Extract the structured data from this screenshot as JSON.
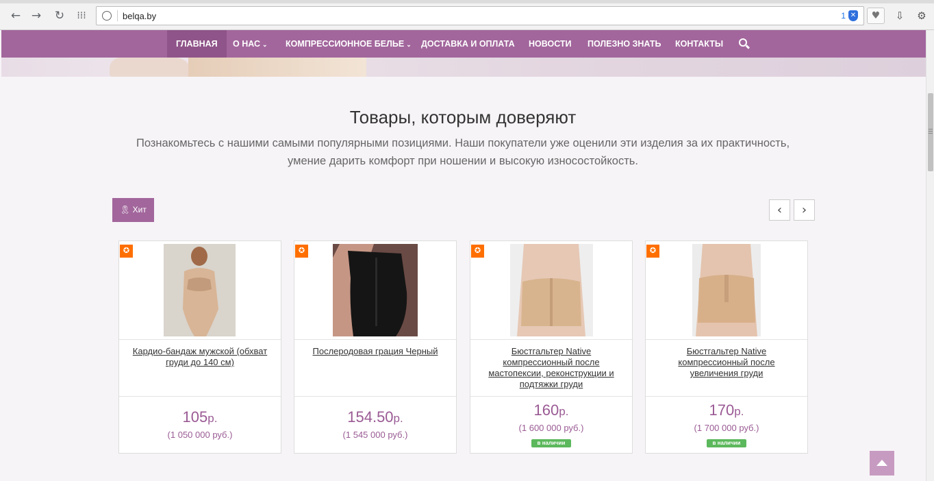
{
  "browser": {
    "url": "belqa.by",
    "counter": "1",
    "back_icon": "back-arrow-icon",
    "forward_icon": "forward-arrow-icon",
    "reload_icon": "reload-icon",
    "apps_icon": "apps-grid-icon"
  },
  "nav": {
    "items": [
      {
        "label": "ГЛАВНАЯ"
      },
      {
        "label": "О НАС"
      },
      {
        "label": "КОМПРЕССИОННОЕ БЕЛЬЕ"
      },
      {
        "label": "ДОСТАВКА И ОПЛАТА"
      },
      {
        "label": "НОВОСТИ"
      },
      {
        "label": "ПОЛЕЗНО ЗНАТЬ"
      },
      {
        "label": "КОНТАКТЫ"
      }
    ],
    "chevron": "⌄"
  },
  "section": {
    "title": "Товары, которым доверяют",
    "description": "Познакомьтесь с нашими самыми популярными позициями. Наши покупатели уже оценили эти изделия за их практичность, умение дарить комфорт при ношении и высокую износостойкость."
  },
  "filter": {
    "hit_label": "🎗 Хит",
    "prev": "‹",
    "next": "›"
  },
  "products": [
    {
      "name": "Кардио-бандаж мужской (обхват груди до 140 см)",
      "price": "105",
      "currency": "р.",
      "old_price": "(1 050 000 руб.)",
      "stock": ""
    },
    {
      "name": "Послеродовая грация Черный",
      "price": "154.50",
      "currency": "р.",
      "old_price": "(1 545 000 руб.)",
      "stock": ""
    },
    {
      "name": "Бюстгальтер Native компрессионный после мастопексии, реконструкции и подтяжки груди",
      "price": "160",
      "currency": "р.",
      "old_price": "(1 600 000 руб.)",
      "stock": "в наличии"
    },
    {
      "name": "Бюстгальтер Native компрессионный после увеличения груди",
      "price": "170",
      "currency": "р.",
      "old_price": "(1 700 000 руб.)",
      "stock": "в наличии"
    }
  ],
  "colors": {
    "brand": "#a2669c",
    "badge": "#ff6f00",
    "stock": "#5cb85c"
  }
}
